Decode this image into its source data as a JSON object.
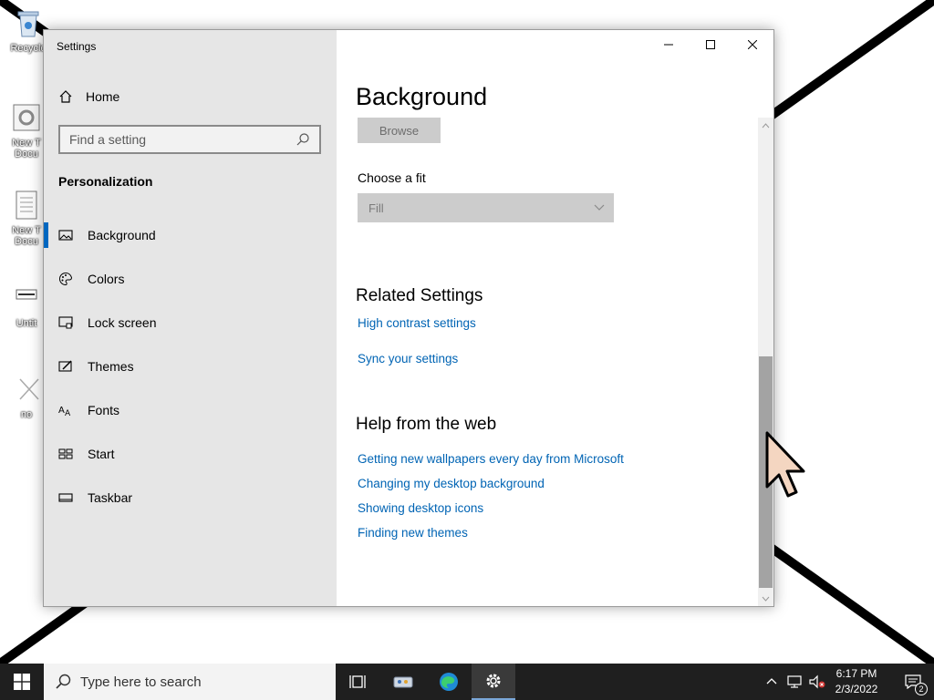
{
  "desktop": {
    "icons": [
      {
        "label": "Recycle"
      },
      {
        "label": "New T Docu"
      },
      {
        "label": "New T Docu"
      },
      {
        "label": "Untit"
      },
      {
        "label": "no"
      }
    ]
  },
  "window": {
    "title": "Settings",
    "home_label": "Home",
    "search_placeholder": "Find a setting",
    "section_title": "Personalization",
    "nav": [
      {
        "label": "Background",
        "icon": "image-icon",
        "active": true
      },
      {
        "label": "Colors",
        "icon": "palette-icon",
        "active": false
      },
      {
        "label": "Lock screen",
        "icon": "lock-screen-icon",
        "active": false
      },
      {
        "label": "Themes",
        "icon": "themes-icon",
        "active": false
      },
      {
        "label": "Fonts",
        "icon": "fonts-icon",
        "active": false
      },
      {
        "label": "Start",
        "icon": "start-icon",
        "active": false
      },
      {
        "label": "Taskbar",
        "icon": "taskbar-icon",
        "active": false
      }
    ],
    "content": {
      "page_title": "Background",
      "browse_label": "Browse",
      "fit_label": "Choose a fit",
      "fit_value": "Fill",
      "related_title": "Related Settings",
      "related_links": [
        "High contrast settings",
        "Sync your settings"
      ],
      "help_title": "Help from the web",
      "help_links": [
        "Getting new wallpapers every day from Microsoft",
        "Changing my desktop background",
        "Showing desktop icons",
        "Finding new themes"
      ]
    }
  },
  "taskbar": {
    "search_placeholder": "Type here to search",
    "time": "6:17 PM",
    "date": "2/3/2022",
    "notification_count": "2"
  },
  "colors": {
    "accent": "#0067c0",
    "link": "#0064b4",
    "taskbar": "#1f1f1f",
    "left_pane": "#e6e6e6"
  }
}
